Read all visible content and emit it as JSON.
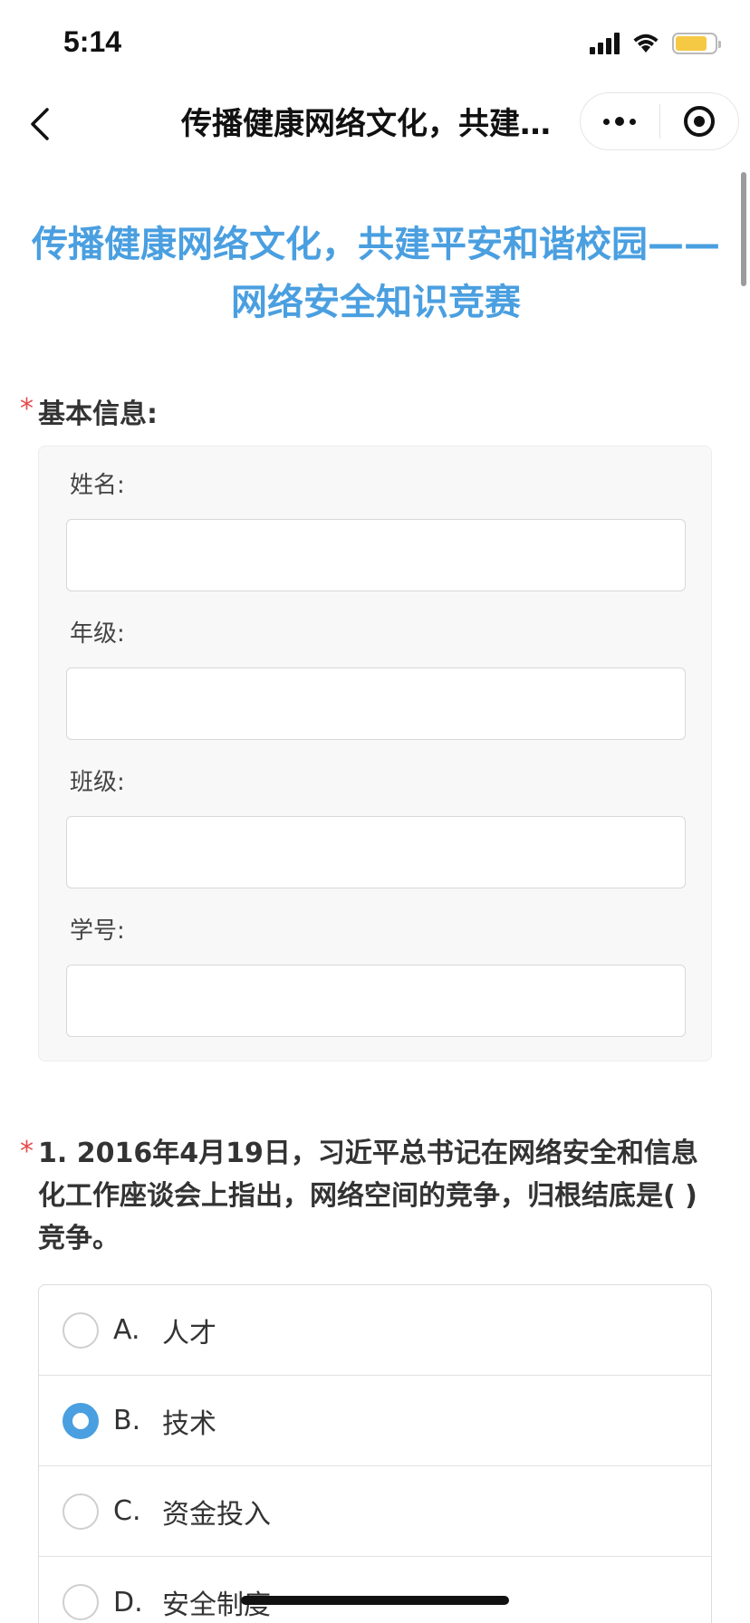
{
  "status_bar": {
    "time": "5:14",
    "icons": [
      "cellular-signal-icon",
      "wifi-icon",
      "battery-icon"
    ],
    "battery_color": "#f6c944"
  },
  "nav": {
    "title": "传播健康网络文化，共建…",
    "icons": [
      "back-chevron-icon",
      "more-dots-icon",
      "record-target-icon"
    ]
  },
  "form": {
    "title": "传播健康网络文化，共建平安和谐校园——网络安全知识竞赛",
    "title_color": "#4a9fe0",
    "required_mark": "*",
    "basic_info": {
      "label": "基本信息:",
      "fields": [
        {
          "label": "姓名:",
          "value": ""
        },
        {
          "label": "年级:",
          "value": ""
        },
        {
          "label": "班级:",
          "value": ""
        },
        {
          "label": "学号:",
          "value": ""
        }
      ]
    },
    "question1": {
      "text": "1. 2016年4月19日，习近平总书记在网络安全和信息化工作座谈会上指出，网络空间的竞争，归根结底是( )竞争。",
      "options": [
        {
          "letter": "A.",
          "text": "人才",
          "selected": false
        },
        {
          "letter": "B.",
          "text": "技术",
          "selected": true
        },
        {
          "letter": "C.",
          "text": "资金投入",
          "selected": false
        },
        {
          "letter": "D.",
          "text": "安全制度",
          "selected": false
        }
      ],
      "accent_color": "#4a9fe0"
    }
  }
}
